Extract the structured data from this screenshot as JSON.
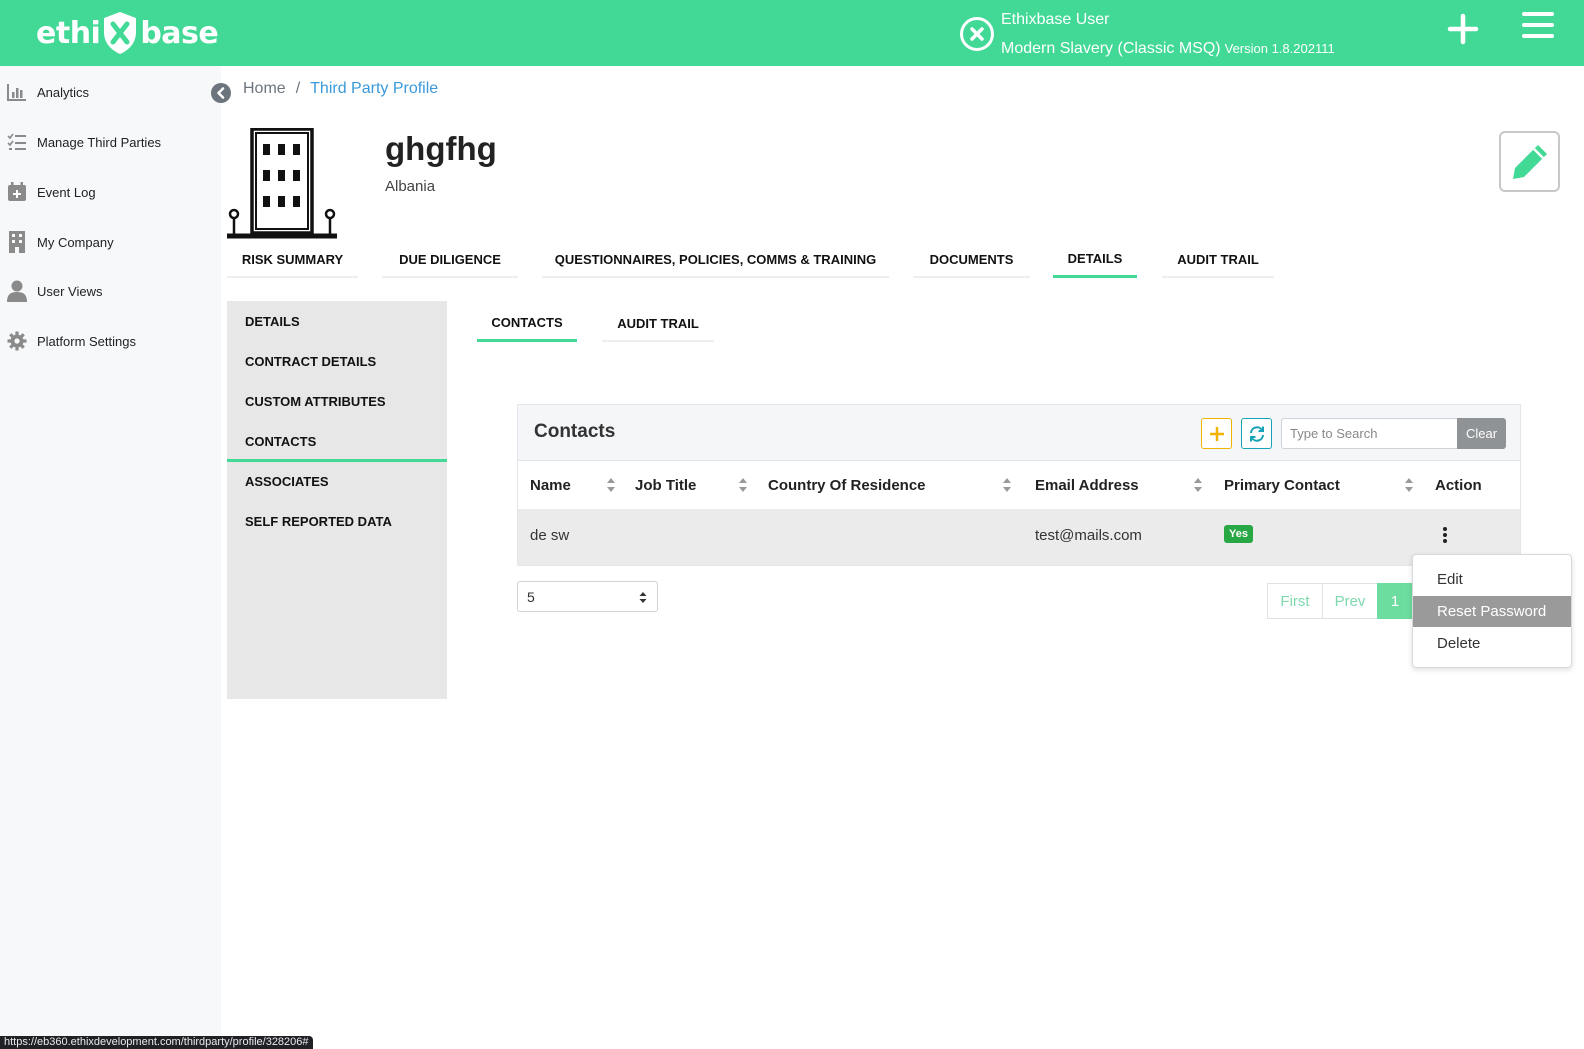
{
  "header": {
    "logo_left": "ethi",
    "logo_right": "base",
    "user_name": "Ethixbase User",
    "workspace": "Modern Slavery (Classic MSQ)",
    "version": "Version 1.8.202111",
    "brand_color": "#42d996"
  },
  "sidebar": {
    "items": [
      {
        "label": "Analytics",
        "icon": "chart-bar-icon"
      },
      {
        "label": "Manage Third Parties",
        "icon": "list-icon"
      },
      {
        "label": "Event Log",
        "icon": "calendar-plus-icon"
      },
      {
        "label": "My Company",
        "icon": "building-icon"
      },
      {
        "label": "User Views",
        "icon": "user-icon"
      },
      {
        "label": "Platform Settings",
        "icon": "gear-icon"
      }
    ]
  },
  "breadcrumb": {
    "home": "Home",
    "separator": "/",
    "current": "Third Party Profile"
  },
  "profile": {
    "name": "ghgfhg",
    "country": "Albania"
  },
  "main_tabs": [
    {
      "label": "RISK SUMMARY",
      "active": false
    },
    {
      "label": "DUE DILIGENCE",
      "active": false
    },
    {
      "label": "QUESTIONNAIRES, POLICIES, COMMS & TRAINING",
      "active": false
    },
    {
      "label": "DOCUMENTS",
      "active": false
    },
    {
      "label": "DETAILS",
      "active": true
    },
    {
      "label": "AUDIT TRAIL",
      "active": false
    }
  ],
  "detail_menu": [
    {
      "label": "DETAILS"
    },
    {
      "label": "CONTRACT DETAILS"
    },
    {
      "label": "CUSTOM ATTRIBUTES"
    },
    {
      "label": "CONTACTS",
      "active": true
    },
    {
      "label": "ASSOCIATES"
    },
    {
      "label": "SELF REPORTED DATA"
    }
  ],
  "sub_tabs": [
    {
      "label": "CONTACTS",
      "active": true
    },
    {
      "label": "AUDIT TRAIL",
      "active": false
    }
  ],
  "contacts": {
    "title": "Contacts",
    "search_placeholder": "Type to Search",
    "clear_label": "Clear",
    "columns": [
      "Name",
      "Job Title",
      "Country Of Residence",
      "Email Address",
      "Primary Contact",
      "Action"
    ],
    "rows": [
      {
        "name": "de sw",
        "job_title": "",
        "country": "",
        "email": "test@mails.com",
        "primary": "Yes"
      }
    ]
  },
  "pagination": {
    "page_size": "5",
    "first": "First",
    "prev": "Prev",
    "current_page": "1"
  },
  "action_menu": {
    "items": [
      "Edit",
      "Reset Password",
      "Delete"
    ],
    "hovered": "Reset Password"
  },
  "status_url": "https://eb360.ethixdevelopment.com/thirdparty/profile/328206#"
}
